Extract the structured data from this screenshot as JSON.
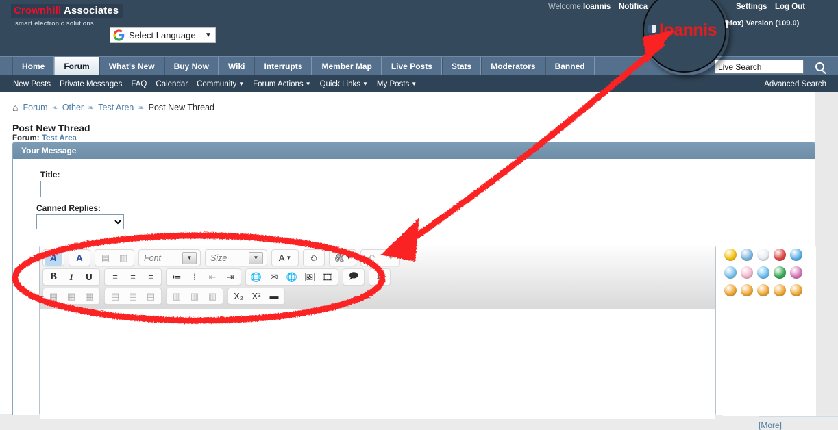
{
  "header": {
    "logo_brand": "Crownhill",
    "logo_brand2": "Associates",
    "logo_tagline": "smart electronic solutions",
    "language_label": "Select Language",
    "language_caret": "▼",
    "welcome_label": "Welcome,",
    "welcome_user": "Ioannis",
    "notifications_label": "Notifica",
    "settings_label": "Settings",
    "logout_label": "Log Out",
    "browser_note": "ng with (Firefox) Version (109.0)",
    "magnified_user": "Ioannis"
  },
  "nav": {
    "tabs": [
      {
        "label": "Home",
        "active": false
      },
      {
        "label": "Forum",
        "active": true
      },
      {
        "label": "What's New",
        "active": false
      },
      {
        "label": "Buy Now",
        "active": false
      },
      {
        "label": "Wiki",
        "active": false
      },
      {
        "label": "Interrupts",
        "active": false
      },
      {
        "label": "Member Map",
        "active": false
      },
      {
        "label": "Live Posts",
        "active": false
      },
      {
        "label": "Stats",
        "active": false
      },
      {
        "label": "Moderators",
        "active": false
      },
      {
        "label": "Banned",
        "active": false
      }
    ]
  },
  "search": {
    "value": "Live Search",
    "placeholder": "Live Search",
    "advanced_label": "Advanced Search",
    "icon": "search-icon"
  },
  "subnav": {
    "items": [
      {
        "label": "New Posts",
        "caret": false
      },
      {
        "label": "Private Messages",
        "caret": false
      },
      {
        "label": "FAQ",
        "caret": false
      },
      {
        "label": "Calendar",
        "caret": false
      },
      {
        "label": "Community",
        "caret": true
      },
      {
        "label": "Forum Actions",
        "caret": true
      },
      {
        "label": "Quick Links",
        "caret": true
      },
      {
        "label": "My Posts",
        "caret": true
      }
    ],
    "caret_glyph": "▼"
  },
  "breadcrumb": {
    "home_icon": "home-icon",
    "separator": "❧",
    "items": [
      {
        "label": "Forum",
        "link": true
      },
      {
        "label": "Other",
        "link": true
      },
      {
        "label": "Test Area",
        "link": true
      },
      {
        "label": "Post New Thread",
        "link": false
      }
    ]
  },
  "page": {
    "title": "Post New Thread",
    "forum_prefix": "Forum:",
    "forum_name": "Test Area",
    "panel_header": "Your Message"
  },
  "form": {
    "title_label": "Title:",
    "title_value": "",
    "title_placeholder": "",
    "canned_label": "Canned Replies:",
    "canned_selected": "",
    "canned_options": [
      ""
    ]
  },
  "editor": {
    "toolbar_rows": [
      [
        {
          "group": [
            {
              "name": "wysiwyg-toggle-icon",
              "glyph": "A",
              "state": "selected"
            }
          ]
        },
        {
          "group": [
            {
              "name": "remove-formatting-icon",
              "glyph": "A",
              "state": "normal"
            }
          ]
        },
        {
          "group": [
            {
              "name": "paste-icon",
              "glyph": "▤",
              "state": "disabled"
            },
            {
              "name": "paste-from-word-icon",
              "glyph": "▥",
              "state": "disabled"
            }
          ]
        },
        {
          "group": [
            {
              "name": "font-family-select",
              "glyph": "Font",
              "state": "dropdown"
            }
          ]
        },
        {
          "group": [
            {
              "name": "font-size-select",
              "glyph": "Size",
              "state": "dropdown"
            }
          ]
        },
        {
          "group": [
            {
              "name": "font-color-icon",
              "glyph": "A",
              "state": "caret"
            }
          ]
        },
        {
          "group": [
            {
              "name": "smilies-icon",
              "glyph": "☺",
              "state": "normal"
            }
          ]
        },
        {
          "group": [
            {
              "name": "attachment-icon",
              "glyph": "🖇",
              "state": "caret"
            }
          ]
        },
        {
          "group": [
            {
              "name": "undo-icon",
              "glyph": "↶",
              "state": "disabled"
            },
            {
              "name": "redo-icon",
              "glyph": "↷",
              "state": "disabled"
            }
          ]
        }
      ],
      [
        {
          "group": [
            {
              "name": "bold-icon",
              "glyph": "B",
              "state": "bold"
            },
            {
              "name": "italic-icon",
              "glyph": "I",
              "state": "italic"
            },
            {
              "name": "underline-icon",
              "glyph": "U",
              "state": "underline"
            }
          ]
        },
        {
          "group": [
            {
              "name": "align-left-icon",
              "glyph": "≡",
              "state": "normal"
            },
            {
              "name": "align-center-icon",
              "glyph": "≡",
              "state": "normal"
            },
            {
              "name": "align-right-icon",
              "glyph": "≡",
              "state": "normal"
            }
          ]
        },
        {
          "group": [
            {
              "name": "ordered-list-icon",
              "glyph": "≔",
              "state": "normal"
            },
            {
              "name": "unordered-list-icon",
              "glyph": "⁞",
              "state": "normal"
            },
            {
              "name": "outdent-icon",
              "glyph": "⇤",
              "state": "disabled"
            },
            {
              "name": "indent-icon",
              "glyph": "⇥",
              "state": "normal"
            }
          ]
        },
        {
          "group": [
            {
              "name": "insert-link-icon",
              "glyph": "🌐",
              "state": "normal"
            },
            {
              "name": "insert-email-icon",
              "glyph": "✉",
              "state": "normal"
            },
            {
              "name": "remove-link-icon",
              "glyph": "🌐",
              "state": "normal"
            },
            {
              "name": "insert-image-icon",
              "glyph": "🖼",
              "state": "normal"
            },
            {
              "name": "insert-video-icon",
              "glyph": "🎞",
              "state": "normal"
            }
          ]
        },
        {
          "group": [
            {
              "name": "quote-icon",
              "glyph": "🗩",
              "state": "normal"
            }
          ]
        },
        {
          "group": [
            {
              "name": "code-icon",
              "glyph": "#",
              "state": "normal"
            }
          ]
        }
      ],
      [
        {
          "group": [
            {
              "name": "insert-table-icon",
              "glyph": "▦",
              "state": "disabled"
            },
            {
              "name": "table-properties-icon",
              "glyph": "▦",
              "state": "disabled"
            },
            {
              "name": "delete-table-icon",
              "glyph": "▦",
              "state": "disabled"
            }
          ]
        },
        {
          "group": [
            {
              "name": "insert-row-before-icon",
              "glyph": "▤",
              "state": "disabled"
            },
            {
              "name": "insert-row-after-icon",
              "glyph": "▤",
              "state": "disabled"
            },
            {
              "name": "delete-row-icon",
              "glyph": "▤",
              "state": "disabled"
            }
          ]
        },
        {
          "group": [
            {
              "name": "insert-column-before-icon",
              "glyph": "▥",
              "state": "disabled"
            },
            {
              "name": "insert-column-after-icon",
              "glyph": "▥",
              "state": "disabled"
            },
            {
              "name": "delete-column-icon",
              "glyph": "▥",
              "state": "disabled"
            }
          ]
        },
        {
          "group": [
            {
              "name": "subscript-icon",
              "glyph": "X₂",
              "state": "normal"
            },
            {
              "name": "superscript-icon",
              "glyph": "X²",
              "state": "normal"
            },
            {
              "name": "horizontal-rule-icon",
              "glyph": "▬",
              "state": "normal"
            }
          ]
        }
      ]
    ],
    "body_value": ""
  },
  "smilies": {
    "more_label": "[More]",
    "rows": [
      [
        {
          "name": "smiley-happy",
          "color": "#f5c518",
          "face": ":)"
        },
        {
          "name": "smiley-confused",
          "color": "#7fb8e0",
          "face": "???"
        },
        {
          "name": "smiley-eek",
          "color": "#e9eef2",
          "face": "8o"
        },
        {
          "name": "smiley-angry",
          "color": "#e04b4b",
          "face": ">:("
        },
        {
          "name": "smiley-cool-blue",
          "color": "#5fb3e8",
          "face": "^^"
        }
      ],
      [
        {
          "name": "smiley-sunglasses",
          "color": "#7fc3ec",
          "face": "B)"
        },
        {
          "name": "smiley-blush",
          "color": "#f3b8d0",
          "face": ":$"
        },
        {
          "name": "smiley-wink",
          "color": "#6fc2ef",
          "face": ";)"
        },
        {
          "name": "smiley-grin-green",
          "color": "#3eaa5a",
          "face": ":D"
        },
        {
          "name": "smiley-pink",
          "color": "#d879b8",
          "face": ":P"
        }
      ],
      [
        {
          "name": "smiley-laugh",
          "color": "#f0a93a",
          "face": "^_^"
        },
        {
          "name": "smiley-biggrin",
          "color": "#f0a93a",
          "face": ":D"
        },
        {
          "name": "smiley-frown",
          "color": "#f0a93a",
          "face": ":("
        },
        {
          "name": "smiley-tongue",
          "color": "#f0a93a",
          "face": ":P"
        },
        {
          "name": "smiley-smile-small",
          "color": "#f0a93a",
          "face": ":)"
        }
      ]
    ]
  },
  "colors": {
    "header_bg": "#34495b",
    "nav_bg": "#54708c",
    "subnav_bg": "#2f4356",
    "panel_header": "#7190ab",
    "link": "#4d7ea8",
    "brand_red": "#e8102a",
    "annotation_red": "#fa2020"
  }
}
